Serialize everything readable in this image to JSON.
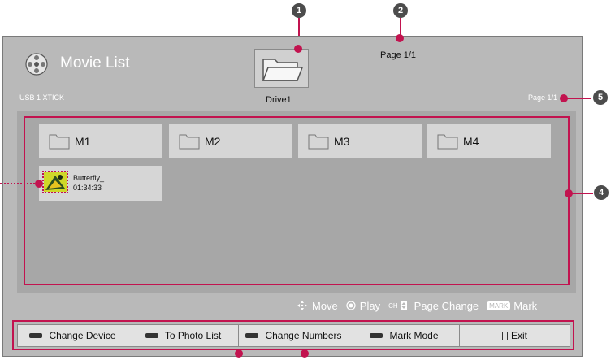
{
  "header": {
    "title": "Movie List",
    "device": "USB 1 XTICK",
    "page_top": "Page 1/1",
    "page_right": "Page 1/1",
    "drive_label": "Drive1"
  },
  "folders": [
    "M1",
    "M2",
    "M3",
    "M4"
  ],
  "movie": {
    "name": "Butterfly_...",
    "duration": "01:34:33"
  },
  "hints": {
    "move": "Move",
    "play": "Play",
    "ch_icon": "CH",
    "page_change": "Page Change",
    "mark_icon": "MARK",
    "mark": "Mark"
  },
  "buttons": {
    "change_device": "Change Device",
    "to_photo_list": "To Photo List",
    "change_numbers": "Change Numbers",
    "mark_mode": "Mark Mode",
    "exit": "Exit"
  },
  "callouts": [
    "1",
    "2",
    "4",
    "5"
  ],
  "colors": {
    "panel": "#b9b9b9",
    "content": "#a7a7a7",
    "highlight": "#c2134f",
    "callout": "#4c4c4c"
  }
}
